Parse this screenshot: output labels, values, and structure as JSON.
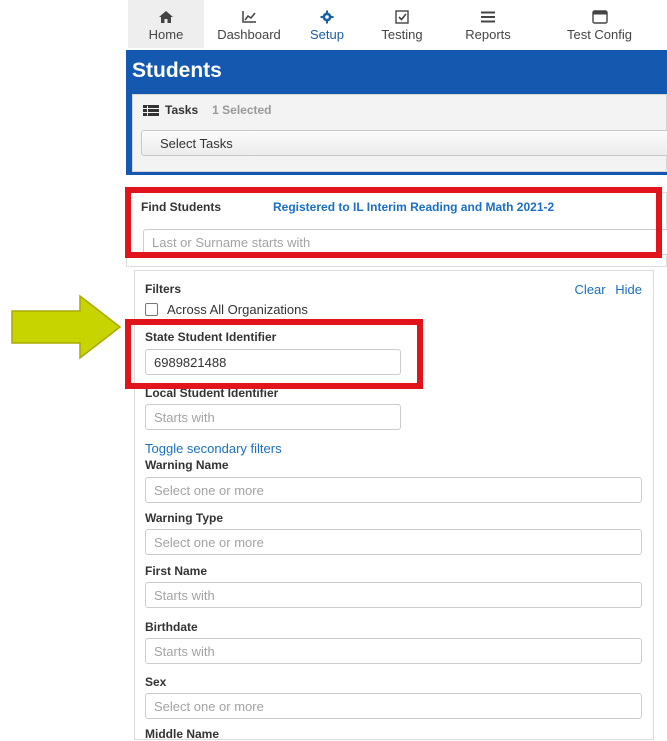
{
  "nav": {
    "items": [
      {
        "label": "Home",
        "icon": "home-icon"
      },
      {
        "label": "Dashboard",
        "icon": "chart-icon"
      },
      {
        "label": "Setup",
        "icon": "gear-icon"
      },
      {
        "label": "Testing",
        "icon": "checkbox-icon"
      },
      {
        "label": "Reports",
        "icon": "list-icon"
      },
      {
        "label": "Test Config",
        "icon": "window-icon"
      }
    ],
    "active": "Home",
    "accent_color": "#1a5ea8"
  },
  "students": {
    "title": "Students",
    "panel_color": "#1558b0",
    "tasks": {
      "label": "Tasks",
      "count": "1 Selected",
      "select_label": "Select Tasks"
    }
  },
  "find": {
    "label": "Find Students",
    "link": "Registered to IL Interim Reading and Math 2021-2",
    "placeholder": "Last or Surname starts with"
  },
  "filters": {
    "title": "Filters",
    "clear": "Clear",
    "hide": "Hide",
    "across_all": "Across All Organizations",
    "toggle_secondary": "Toggle secondary filters",
    "state_id": {
      "label": "State Student Identifier",
      "value": "6989821488"
    },
    "local_id": {
      "label": "Local Student Identifier",
      "placeholder": "Starts with"
    },
    "warning_name": {
      "label": "Warning Name",
      "placeholder": "Select one or more"
    },
    "warning_type": {
      "label": "Warning Type",
      "placeholder": "Select one or more"
    },
    "first_name": {
      "label": "First Name",
      "placeholder": "Starts with"
    },
    "birthdate": {
      "label": "Birthdate",
      "placeholder": "Starts with"
    },
    "sex": {
      "label": "Sex",
      "placeholder": "Select one or more"
    },
    "middle_name": {
      "label": "Middle Name"
    }
  },
  "highlight_color": "#e0141a",
  "arrow_color": "#c8d400"
}
